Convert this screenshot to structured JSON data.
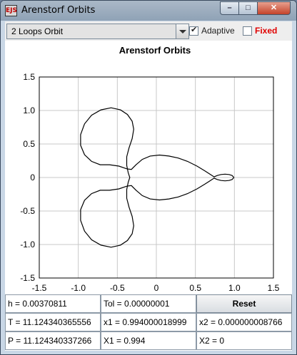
{
  "window": {
    "title": "Arenstorf Orbits",
    "icon_letters": "EJS",
    "controls": {
      "minimize": "–",
      "maximize": "□",
      "close": "✕"
    }
  },
  "toolbar": {
    "orbit_select": {
      "selected": "2 Loops Orbit"
    },
    "adaptive": {
      "label": "Adaptive",
      "checked": true
    },
    "fixed": {
      "label": "Fixed",
      "checked": false,
      "color": "#e00000"
    }
  },
  "chart_data": {
    "type": "line",
    "title": "Arenstorf Orbits",
    "xlim": [
      -1.5,
      1.5
    ],
    "ylim": [
      -1.5,
      1.5
    ],
    "xticks": [
      "-1.5",
      "-1.0",
      "-0.5",
      "0",
      "0.5",
      "1.0",
      "1.5"
    ],
    "yticks": [
      "1.5",
      "1.0",
      "0.5",
      "0",
      "-0.5",
      "-1.0",
      "-1.5"
    ],
    "grid": true,
    "series": [
      {
        "points": [
          [
            0.994,
            0.0
          ],
          [
            0.97,
            0.03
          ],
          [
            0.93,
            0.045
          ],
          [
            0.88,
            0.05
          ],
          [
            0.83,
            0.045
          ],
          [
            0.78,
            0.03
          ],
          [
            0.74,
            0.01
          ],
          [
            0.7,
            0.04
          ],
          [
            0.62,
            0.1
          ],
          [
            0.52,
            0.17
          ],
          [
            0.4,
            0.24
          ],
          [
            0.28,
            0.29
          ],
          [
            0.16,
            0.32
          ],
          [
            0.04,
            0.335
          ],
          [
            -0.08,
            0.32
          ],
          [
            -0.18,
            0.27
          ],
          [
            -0.26,
            0.19
          ],
          [
            -0.32,
            0.12
          ],
          [
            -0.38,
            0.13
          ],
          [
            -0.48,
            0.17
          ],
          [
            -0.6,
            0.19
          ],
          [
            -0.72,
            0.19
          ],
          [
            -0.83,
            0.24
          ],
          [
            -0.92,
            0.34
          ],
          [
            -0.97,
            0.48
          ],
          [
            -0.97,
            0.64
          ],
          [
            -0.92,
            0.8
          ],
          [
            -0.83,
            0.93
          ],
          [
            -0.71,
            1.01
          ],
          [
            -0.58,
            1.04
          ],
          [
            -0.46,
            1.01
          ],
          [
            -0.37,
            0.94
          ],
          [
            -0.31,
            0.84
          ],
          [
            -0.29,
            0.72
          ],
          [
            -0.31,
            0.58
          ],
          [
            -0.35,
            0.44
          ],
          [
            -0.38,
            0.31
          ],
          [
            -0.38,
            0.18
          ],
          [
            -0.36,
            0.07
          ],
          [
            -0.34,
            0.0
          ],
          [
            -0.36,
            -0.07
          ],
          [
            -0.38,
            -0.18
          ],
          [
            -0.38,
            -0.31
          ],
          [
            -0.35,
            -0.44
          ],
          [
            -0.31,
            -0.58
          ],
          [
            -0.29,
            -0.72
          ],
          [
            -0.31,
            -0.84
          ],
          [
            -0.37,
            -0.94
          ],
          [
            -0.46,
            -1.01
          ],
          [
            -0.58,
            -1.04
          ],
          [
            -0.71,
            -1.01
          ],
          [
            -0.83,
            -0.93
          ],
          [
            -0.92,
            -0.8
          ],
          [
            -0.97,
            -0.64
          ],
          [
            -0.97,
            -0.48
          ],
          [
            -0.92,
            -0.34
          ],
          [
            -0.83,
            -0.24
          ],
          [
            -0.72,
            -0.19
          ],
          [
            -0.6,
            -0.19
          ],
          [
            -0.48,
            -0.17
          ],
          [
            -0.38,
            -0.13
          ],
          [
            -0.32,
            -0.12
          ],
          [
            -0.26,
            -0.19
          ],
          [
            -0.18,
            -0.27
          ],
          [
            -0.08,
            -0.32
          ],
          [
            0.04,
            -0.335
          ],
          [
            0.16,
            -0.32
          ],
          [
            0.28,
            -0.29
          ],
          [
            0.4,
            -0.24
          ],
          [
            0.52,
            -0.17
          ],
          [
            0.62,
            -0.1
          ],
          [
            0.7,
            -0.04
          ],
          [
            0.74,
            -0.01
          ],
          [
            0.78,
            -0.03
          ],
          [
            0.83,
            -0.045
          ],
          [
            0.88,
            -0.05
          ],
          [
            0.93,
            -0.045
          ],
          [
            0.97,
            -0.03
          ],
          [
            0.994,
            0.0
          ]
        ]
      }
    ]
  },
  "fields": {
    "h": "h = 0.00370811",
    "tol": "Tol = 0.00000001",
    "reset": "Reset",
    "T": "T = 11.124340365556",
    "x1": "x1 = 0.994000018999",
    "x2": "x2 = 0.000000008766",
    "P": "P = 11.124340337266",
    "X1": "X1 = 0.994",
    "X2": "X2 = 0"
  }
}
